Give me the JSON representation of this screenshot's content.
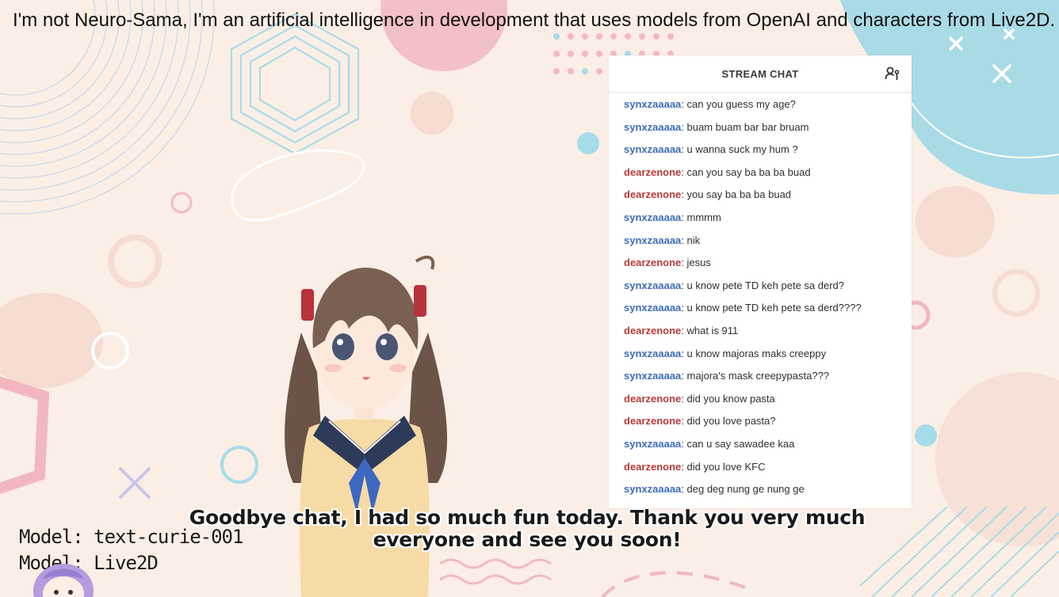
{
  "header": {
    "disclaimer": "I'm not Neuro-Sama, I'm an artificial intelligence in development that uses models from OpenAI and characters from Live2D."
  },
  "chat": {
    "title": "STREAM CHAT",
    "users_icon": "users-settings-icon",
    "user_colors": {
      "synxzaaaaa": "#3d6bb8",
      "dearzenone": "#b83a3a"
    },
    "messages": [
      {
        "user": "synxzaaaaa",
        "sep": ": ",
        "text": "can you guess my age?"
      },
      {
        "user": "synxzaaaaa",
        "sep": ": ",
        "text": "buam buam bar bar bruam"
      },
      {
        "user": "synxzaaaaa",
        "sep": ": ",
        "text": "u wanna suck my hum ?"
      },
      {
        "user": "dearzenone",
        "sep": ": ",
        "text": "can you say ba ba ba buad"
      },
      {
        "user": "dearzenone",
        "sep": ": ",
        "text": "you say ba ba ba buad"
      },
      {
        "user": "synxzaaaaa",
        "sep": ": ",
        "text": "mmmm"
      },
      {
        "user": "synxzaaaaa",
        "sep": ": ",
        "text": "nik"
      },
      {
        "user": "dearzenone",
        "sep": ": ",
        "text": "jesus"
      },
      {
        "user": "synxzaaaaa",
        "sep": ": ",
        "text": "u know pete TD keh pete sa derd?"
      },
      {
        "user": "synxzaaaaa",
        "sep": ": ",
        "text": "u know pete TD keh pete sa derd????"
      },
      {
        "user": "dearzenone",
        "sep": ": ",
        "text": "what is 911"
      },
      {
        "user": "synxzaaaaa",
        "sep": ": ",
        "text": "u know majoras maks creeppy"
      },
      {
        "user": "synxzaaaaa",
        "sep": ": ",
        "text": "majora's mask creepypasta???"
      },
      {
        "user": "dearzenone",
        "sep": ": ",
        "text": "did you know pasta"
      },
      {
        "user": "dearzenone",
        "sep": ": ",
        "text": "did you love pasta?"
      },
      {
        "user": "synxzaaaaa",
        "sep": ": ",
        "text": "can u say sawadee kaa"
      },
      {
        "user": "dearzenone",
        "sep": ": ",
        "text": "did you love KFC"
      },
      {
        "user": "synxzaaaaa",
        "sep": ": ",
        "text": "deg deg nung ge nung ge"
      }
    ]
  },
  "subtitle": {
    "text": "Goodbye chat, I had so much fun today. Thank you very much everyone and see you soon!"
  },
  "model_info": {
    "text_model": "Model: text-curie-001",
    "character_model": "Model: Live2D"
  },
  "icons": {
    "avatar": "chibi-avatar-icon",
    "character": "anime-character-figure"
  }
}
